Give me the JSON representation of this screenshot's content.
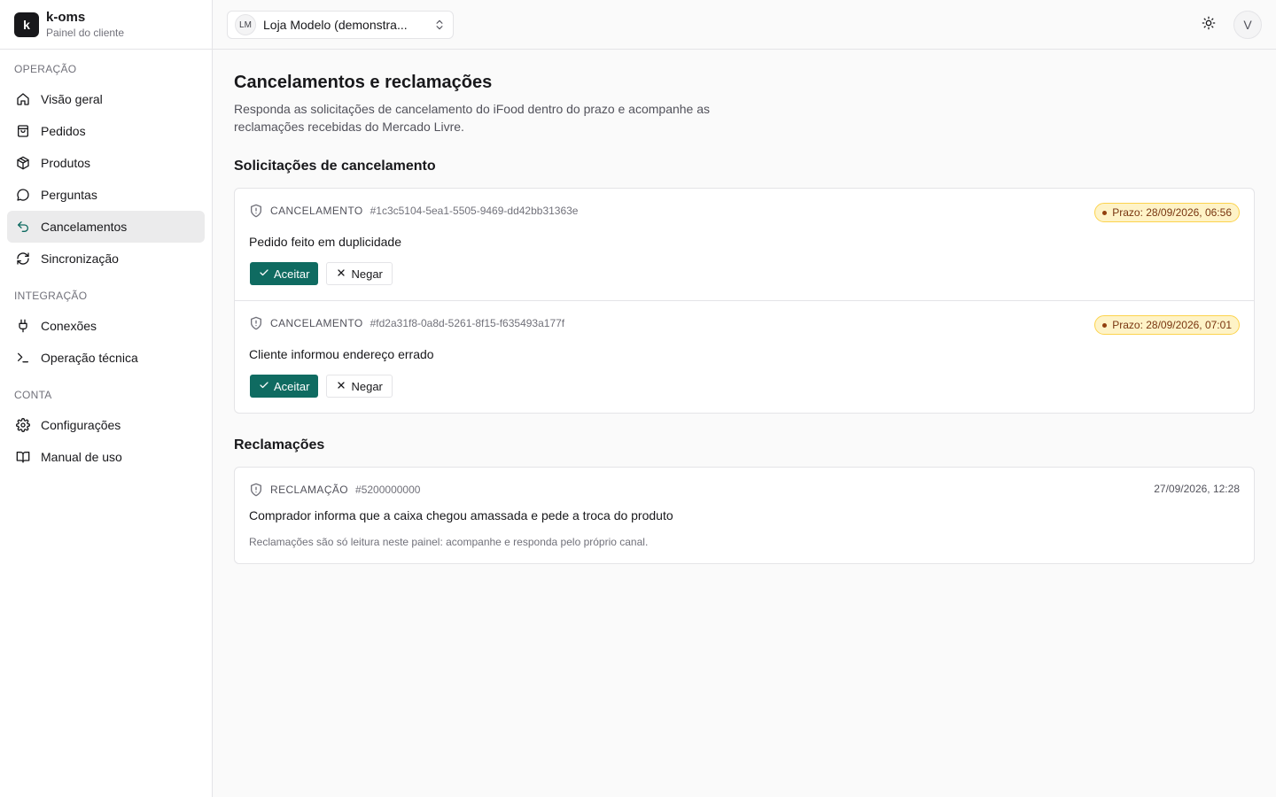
{
  "brand": {
    "logo_letter": "k",
    "name": "k-oms",
    "subtitle": "Painel do cliente"
  },
  "sidebar": {
    "sections": [
      {
        "heading": "OPERAÇÃO",
        "items": [
          {
            "label": "Visão geral",
            "icon": "home-icon"
          },
          {
            "label": "Pedidos",
            "icon": "shopping-bag-icon"
          },
          {
            "label": "Produtos",
            "icon": "package-icon"
          },
          {
            "label": "Perguntas",
            "icon": "message-circle-icon"
          },
          {
            "label": "Cancelamentos",
            "icon": "undo-icon",
            "active": true
          },
          {
            "label": "Sincronização",
            "icon": "refresh-icon"
          }
        ]
      },
      {
        "heading": "INTEGRAÇÃO",
        "items": [
          {
            "label": "Conexões",
            "icon": "plug-icon"
          },
          {
            "label": "Operação técnica",
            "icon": "terminal-icon"
          }
        ]
      },
      {
        "heading": "CONTA",
        "items": [
          {
            "label": "Configurações",
            "icon": "gear-icon"
          },
          {
            "label": "Manual de uso",
            "icon": "book-icon"
          }
        ]
      }
    ]
  },
  "topbar": {
    "store_initials": "LM",
    "store_name": "Loja Modelo (demonstra...",
    "theme_icon": "sun-icon",
    "user_initial": "V"
  },
  "page": {
    "title": "Cancelamentos e reclamações",
    "description": "Responda as solicitações de cancelamento do iFood dentro do prazo e acompanhe as reclamações recebidas do Mercado Livre."
  },
  "cancellations": {
    "title": "Solicitações de cancelamento",
    "accept_label": "Aceitar",
    "deny_label": "Negar",
    "items": [
      {
        "kind": "CANCELAMENTO",
        "id": "#1c3c5104-5ea1-5505-9469-dd42bb31363e",
        "deadline": "Prazo: 28/09/2026, 06:56",
        "reason": "Pedido feito em duplicidade"
      },
      {
        "kind": "CANCELAMENTO",
        "id": "#fd2a31f8-0a8d-5261-8f15-f635493a177f",
        "deadline": "Prazo: 28/09/2026, 07:01",
        "reason": "Cliente informou endereço errado"
      }
    ]
  },
  "claims": {
    "title": "Reclamações",
    "items": [
      {
        "kind": "RECLAMAÇÃO",
        "id": "#5200000000",
        "date": "27/09/2026, 12:28",
        "text": "Comprador informa que a caixa chegou amassada e pede a troca do produto",
        "note": "Reclamações são só leitura neste painel: acompanhe e responda pelo próprio canal."
      }
    ]
  },
  "colors": {
    "accent": "#0f6b61",
    "deadline_bg": "#fef3c7",
    "deadline_border": "#fcd34d",
    "deadline_text": "#78350f"
  }
}
